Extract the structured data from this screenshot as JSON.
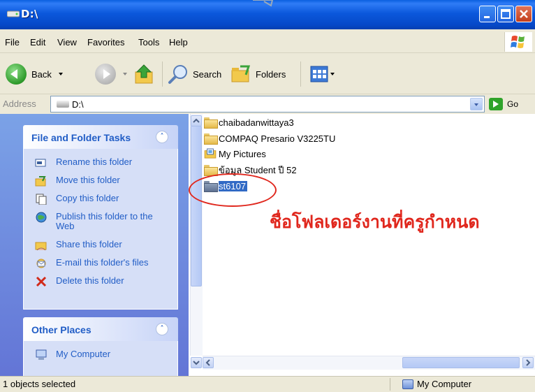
{
  "window": {
    "title": "D:\\",
    "controls": [
      "minimize",
      "maximize",
      "close"
    ]
  },
  "menu": [
    "File",
    "Edit",
    "View",
    "Favorites",
    "Tools",
    "Help"
  ],
  "toolbar": {
    "back_label": "Back",
    "search_label": "Search",
    "folders_label": "Folders"
  },
  "address": {
    "label": "Address",
    "value": "D:\\",
    "go_label": "Go"
  },
  "tasks_panel": {
    "title": "File and Folder Tasks",
    "items": [
      {
        "label": "Rename this folder",
        "icon": "rename-icon"
      },
      {
        "label": "Move this folder",
        "icon": "move-icon"
      },
      {
        "label": "Copy this folder",
        "icon": "copy-icon"
      },
      {
        "label": "Publish this folder to the Web",
        "icon": "publish-web-icon"
      },
      {
        "label": "Share this folder",
        "icon": "share-icon"
      },
      {
        "label": "E-mail this folder's files",
        "icon": "email-icon"
      },
      {
        "label": "Delete this folder",
        "icon": "delete-icon"
      }
    ]
  },
  "places_panel": {
    "title": "Other Places",
    "items": [
      {
        "label": "My Computer",
        "icon": "my-computer-icon"
      }
    ]
  },
  "files": [
    {
      "name": "chaibadanwittaya3",
      "icon": "folder-icon"
    },
    {
      "name": "COMPAQ Presario V3225TU",
      "icon": "folder-icon"
    },
    {
      "name": "My Pictures",
      "icon": "pictures-folder-icon"
    },
    {
      "name": "ข้อมูล Student ปี 52",
      "icon": "folder-icon"
    },
    {
      "name": "st6107",
      "icon": "folder-icon",
      "selected": true
    }
  ],
  "annotation": {
    "text": "ชื่อโฟลเดอร์งานที่ครูกำหนด",
    "color": "#E0271D"
  },
  "status": {
    "left": "1 objects selected",
    "right": "My Computer"
  },
  "colors": {
    "titlebar": "#0B58DC",
    "taskpane": "#7BA2E7",
    "selection": "#316AC5",
    "link": "#215DC6"
  }
}
